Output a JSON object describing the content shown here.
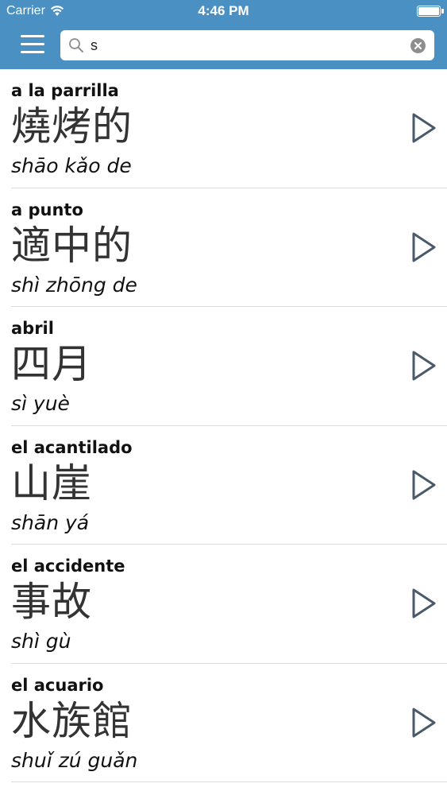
{
  "status_bar": {
    "carrier": "Carrier",
    "time": "4:46 PM",
    "battery_level": 1.0
  },
  "header": {
    "menu_icon": "hamburger-menu-icon",
    "search": {
      "value": "s",
      "icon": "search-icon",
      "clear_icon": "clear-icon"
    }
  },
  "colors": {
    "header": "#4a90c2",
    "divider": "#dcdcdc",
    "play_icon": "#4a5a6a"
  },
  "entries": [
    {
      "spanish": "a la parrilla",
      "chinese": "燒烤的",
      "pinyin": "shāo kǎo de"
    },
    {
      "spanish": "a punto",
      "chinese": "適中的",
      "pinyin": "shì zhōng de"
    },
    {
      "spanish": "abril",
      "chinese": "四月",
      "pinyin": "sì yuè"
    },
    {
      "spanish": "el acantilado",
      "chinese": "山崖",
      "pinyin": "shān yá"
    },
    {
      "spanish": "el accidente",
      "chinese": "事故",
      "pinyin": "shì gù"
    },
    {
      "spanish": "el acuario",
      "chinese": "水族館",
      "pinyin": "shuǐ zú guǎn"
    }
  ]
}
